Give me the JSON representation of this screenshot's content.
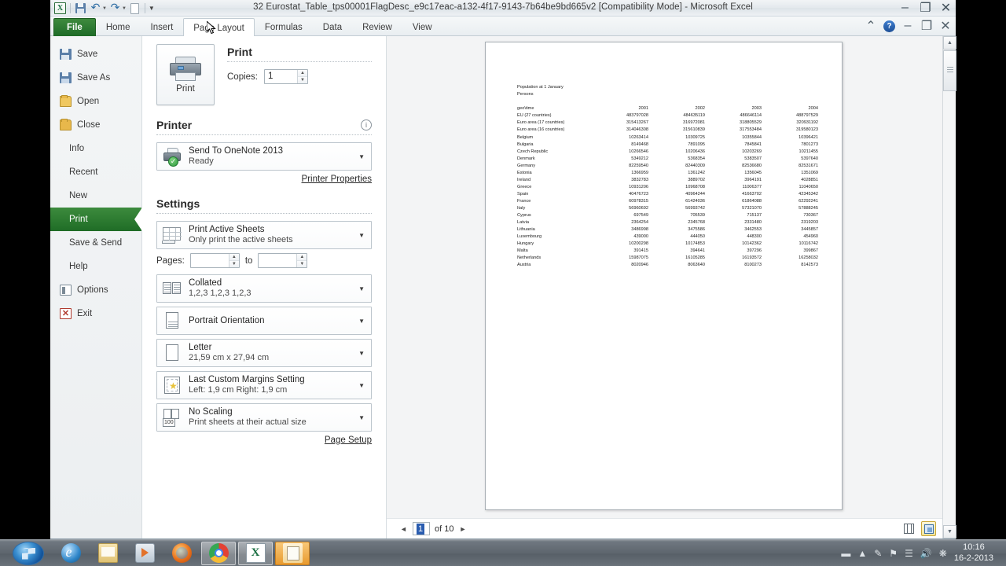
{
  "window": {
    "title": "32 Eurostat_Table_tps00001FlagDesc_e9c17eac-a132-4f17-9143-7b64be9bd665v2  [Compatibility Mode]  -  Microsoft Excel",
    "minimize": "–",
    "restore": "❐",
    "close": "✕",
    "collapse_ribbon": "⌃",
    "help": "?"
  },
  "qat": {
    "excel_logo": "X",
    "save": "save-icon",
    "undo": "↶",
    "redo": "↷",
    "new": "new-icon",
    "customize": "▾"
  },
  "ribbon": {
    "tabs": [
      {
        "label": "File"
      },
      {
        "label": "Home"
      },
      {
        "label": "Insert"
      },
      {
        "label": "Page Layout"
      },
      {
        "label": "Formulas"
      },
      {
        "label": "Data"
      },
      {
        "label": "Review"
      },
      {
        "label": "View"
      }
    ]
  },
  "backstage_nav": {
    "items": [
      {
        "label": "Save",
        "icon": "floppy-icon"
      },
      {
        "label": "Save As",
        "icon": "floppy-as-icon"
      },
      {
        "label": "Open",
        "icon": "folder-open-icon"
      },
      {
        "label": "Close",
        "icon": "folder-close-icon"
      },
      {
        "label": "Info",
        "icon": ""
      },
      {
        "label": "Recent",
        "icon": ""
      },
      {
        "label": "New",
        "icon": ""
      },
      {
        "label": "Print",
        "icon": ""
      },
      {
        "label": "Save & Send",
        "icon": ""
      },
      {
        "label": "Help",
        "icon": ""
      },
      {
        "label": "Options",
        "icon": "options-icon"
      },
      {
        "label": "Exit",
        "icon": "exit-icon"
      }
    ],
    "selected": "Print"
  },
  "print_pane": {
    "print_button_label": "Print",
    "heading": "Print",
    "copies_label": "Copies:",
    "copies_value": "1",
    "printer_heading": "Printer",
    "printer_name": "Send To OneNote 2013",
    "printer_status": "Ready",
    "printer_properties_link": "Printer Properties",
    "settings_heading": "Settings",
    "settings": [
      {
        "title": "Print Active Sheets",
        "subtitle": "Only print the active sheets",
        "icon": "sheet-icon"
      },
      {
        "title": "Collated",
        "subtitle": "1,2,3   1,2,3   1,2,3",
        "icon": "collate-icon"
      },
      {
        "title": "Portrait Orientation",
        "subtitle": "",
        "icon": "portrait-icon"
      },
      {
        "title": "Letter",
        "subtitle": "21,59 cm x 27,94 cm",
        "icon": "paper-icon"
      },
      {
        "title": "Last Custom Margins Setting",
        "subtitle": "Left:  1,9 cm    Right:  1,9 cm",
        "icon": "margins-icon"
      },
      {
        "title": "No Scaling",
        "subtitle": "Print sheets at their actual size",
        "icon": "scaling-icon"
      }
    ],
    "pages_label": "Pages:",
    "pages_from": "",
    "pages_to_label": "to",
    "pages_to": "",
    "page_setup_link": "Page Setup",
    "scaling_badge": "100"
  },
  "preview": {
    "page_current": "1",
    "page_of": "of 10",
    "prev_arrow": "◄",
    "next_arrow": "►",
    "show_margins_icon": "show-margins-icon",
    "zoom_to_page_icon": "zoom-to-page-icon"
  },
  "sheet": {
    "title_line1": "Population at 1 January",
    "title_line2": "Persons",
    "columns": [
      "geo\\time",
      "2001",
      "2002",
      "2003",
      "2004"
    ],
    "rows": [
      {
        "label": "EU (27 countries)",
        "values": [
          "483797028",
          "484635119",
          "486646114",
          "488797529"
        ]
      },
      {
        "label": "Euro area (17 countries)",
        "values": [
          "315413267",
          "316972081",
          "318805529",
          "320931192"
        ]
      },
      {
        "label": "Euro area (16 countries)",
        "values": [
          "314046308",
          "315610839",
          "317553484",
          "319580123"
        ]
      },
      {
        "label": "Belgium",
        "values": [
          "10263414",
          "10309725",
          "10355844",
          "10396421"
        ]
      },
      {
        "label": "Bulgaria",
        "values": [
          "8149468",
          "7891095",
          "7845841",
          "7801273"
        ]
      },
      {
        "label": "Czech Republic",
        "values": [
          "10266546",
          "10206436",
          "10203269",
          "10211455"
        ]
      },
      {
        "label": "Denmark",
        "values": [
          "5349212",
          "5368354",
          "5383507",
          "5397640"
        ]
      },
      {
        "label": "Germany",
        "values": [
          "82259540",
          "82440309",
          "82536680",
          "82531671"
        ]
      },
      {
        "label": "Estonia",
        "values": [
          "1366959",
          "1361242",
          "1356045",
          "1351069"
        ]
      },
      {
        "label": "Ireland",
        "values": [
          "3832783",
          "3889702",
          "3964191",
          "4028851"
        ]
      },
      {
        "label": "Greece",
        "values": [
          "10931206",
          "10968708",
          "11006377",
          "11040650"
        ]
      },
      {
        "label": "Spain",
        "values": [
          "40476723",
          "40964244",
          "41663702",
          "42345342"
        ]
      },
      {
        "label": "France",
        "values": [
          "60978315",
          "61424036",
          "61864088",
          "62292241"
        ]
      },
      {
        "label": "Italy",
        "values": [
          "56960692",
          "56993742",
          "57321070",
          "57888245"
        ]
      },
      {
        "label": "Cyprus",
        "values": [
          "697549",
          "705539",
          "715137",
          "730367"
        ]
      },
      {
        "label": "Latvia",
        "values": [
          "2364254",
          "2345768",
          "2331480",
          "2319203"
        ]
      },
      {
        "label": "Lithuania",
        "values": [
          "3486998",
          "3475586",
          "3462553",
          "3445857"
        ]
      },
      {
        "label": "Luxembourg",
        "values": [
          "439000",
          "444050",
          "448300",
          "454960"
        ]
      },
      {
        "label": "Hungary",
        "values": [
          "10200298",
          "10174853",
          "10142362",
          "10116742"
        ]
      },
      {
        "label": "Malta",
        "values": [
          "391415",
          "394641",
          "397296",
          "399867"
        ]
      },
      {
        "label": "Netherlands",
        "values": [
          "15987075",
          "16105285",
          "16193572",
          "16258032"
        ]
      },
      {
        "label": "Austria",
        "values": [
          "8020946",
          "8063640",
          "8100273",
          "8142573"
        ]
      }
    ]
  },
  "taskbar": {
    "start": "start-orb",
    "buttons": [
      {
        "name": "internet-explorer",
        "active": false
      },
      {
        "name": "file-explorer",
        "active": false
      },
      {
        "name": "windows-media-player",
        "active": false
      },
      {
        "name": "firefox",
        "active": false
      },
      {
        "name": "google-chrome",
        "active": false
      },
      {
        "name": "microsoft-excel",
        "active": false
      },
      {
        "name": "snipping-tool",
        "active": true
      }
    ],
    "tray": [
      "show-hidden-icons",
      "action-center",
      "network",
      "volume"
    ],
    "time": "10:16",
    "date": "16-2-2013"
  }
}
